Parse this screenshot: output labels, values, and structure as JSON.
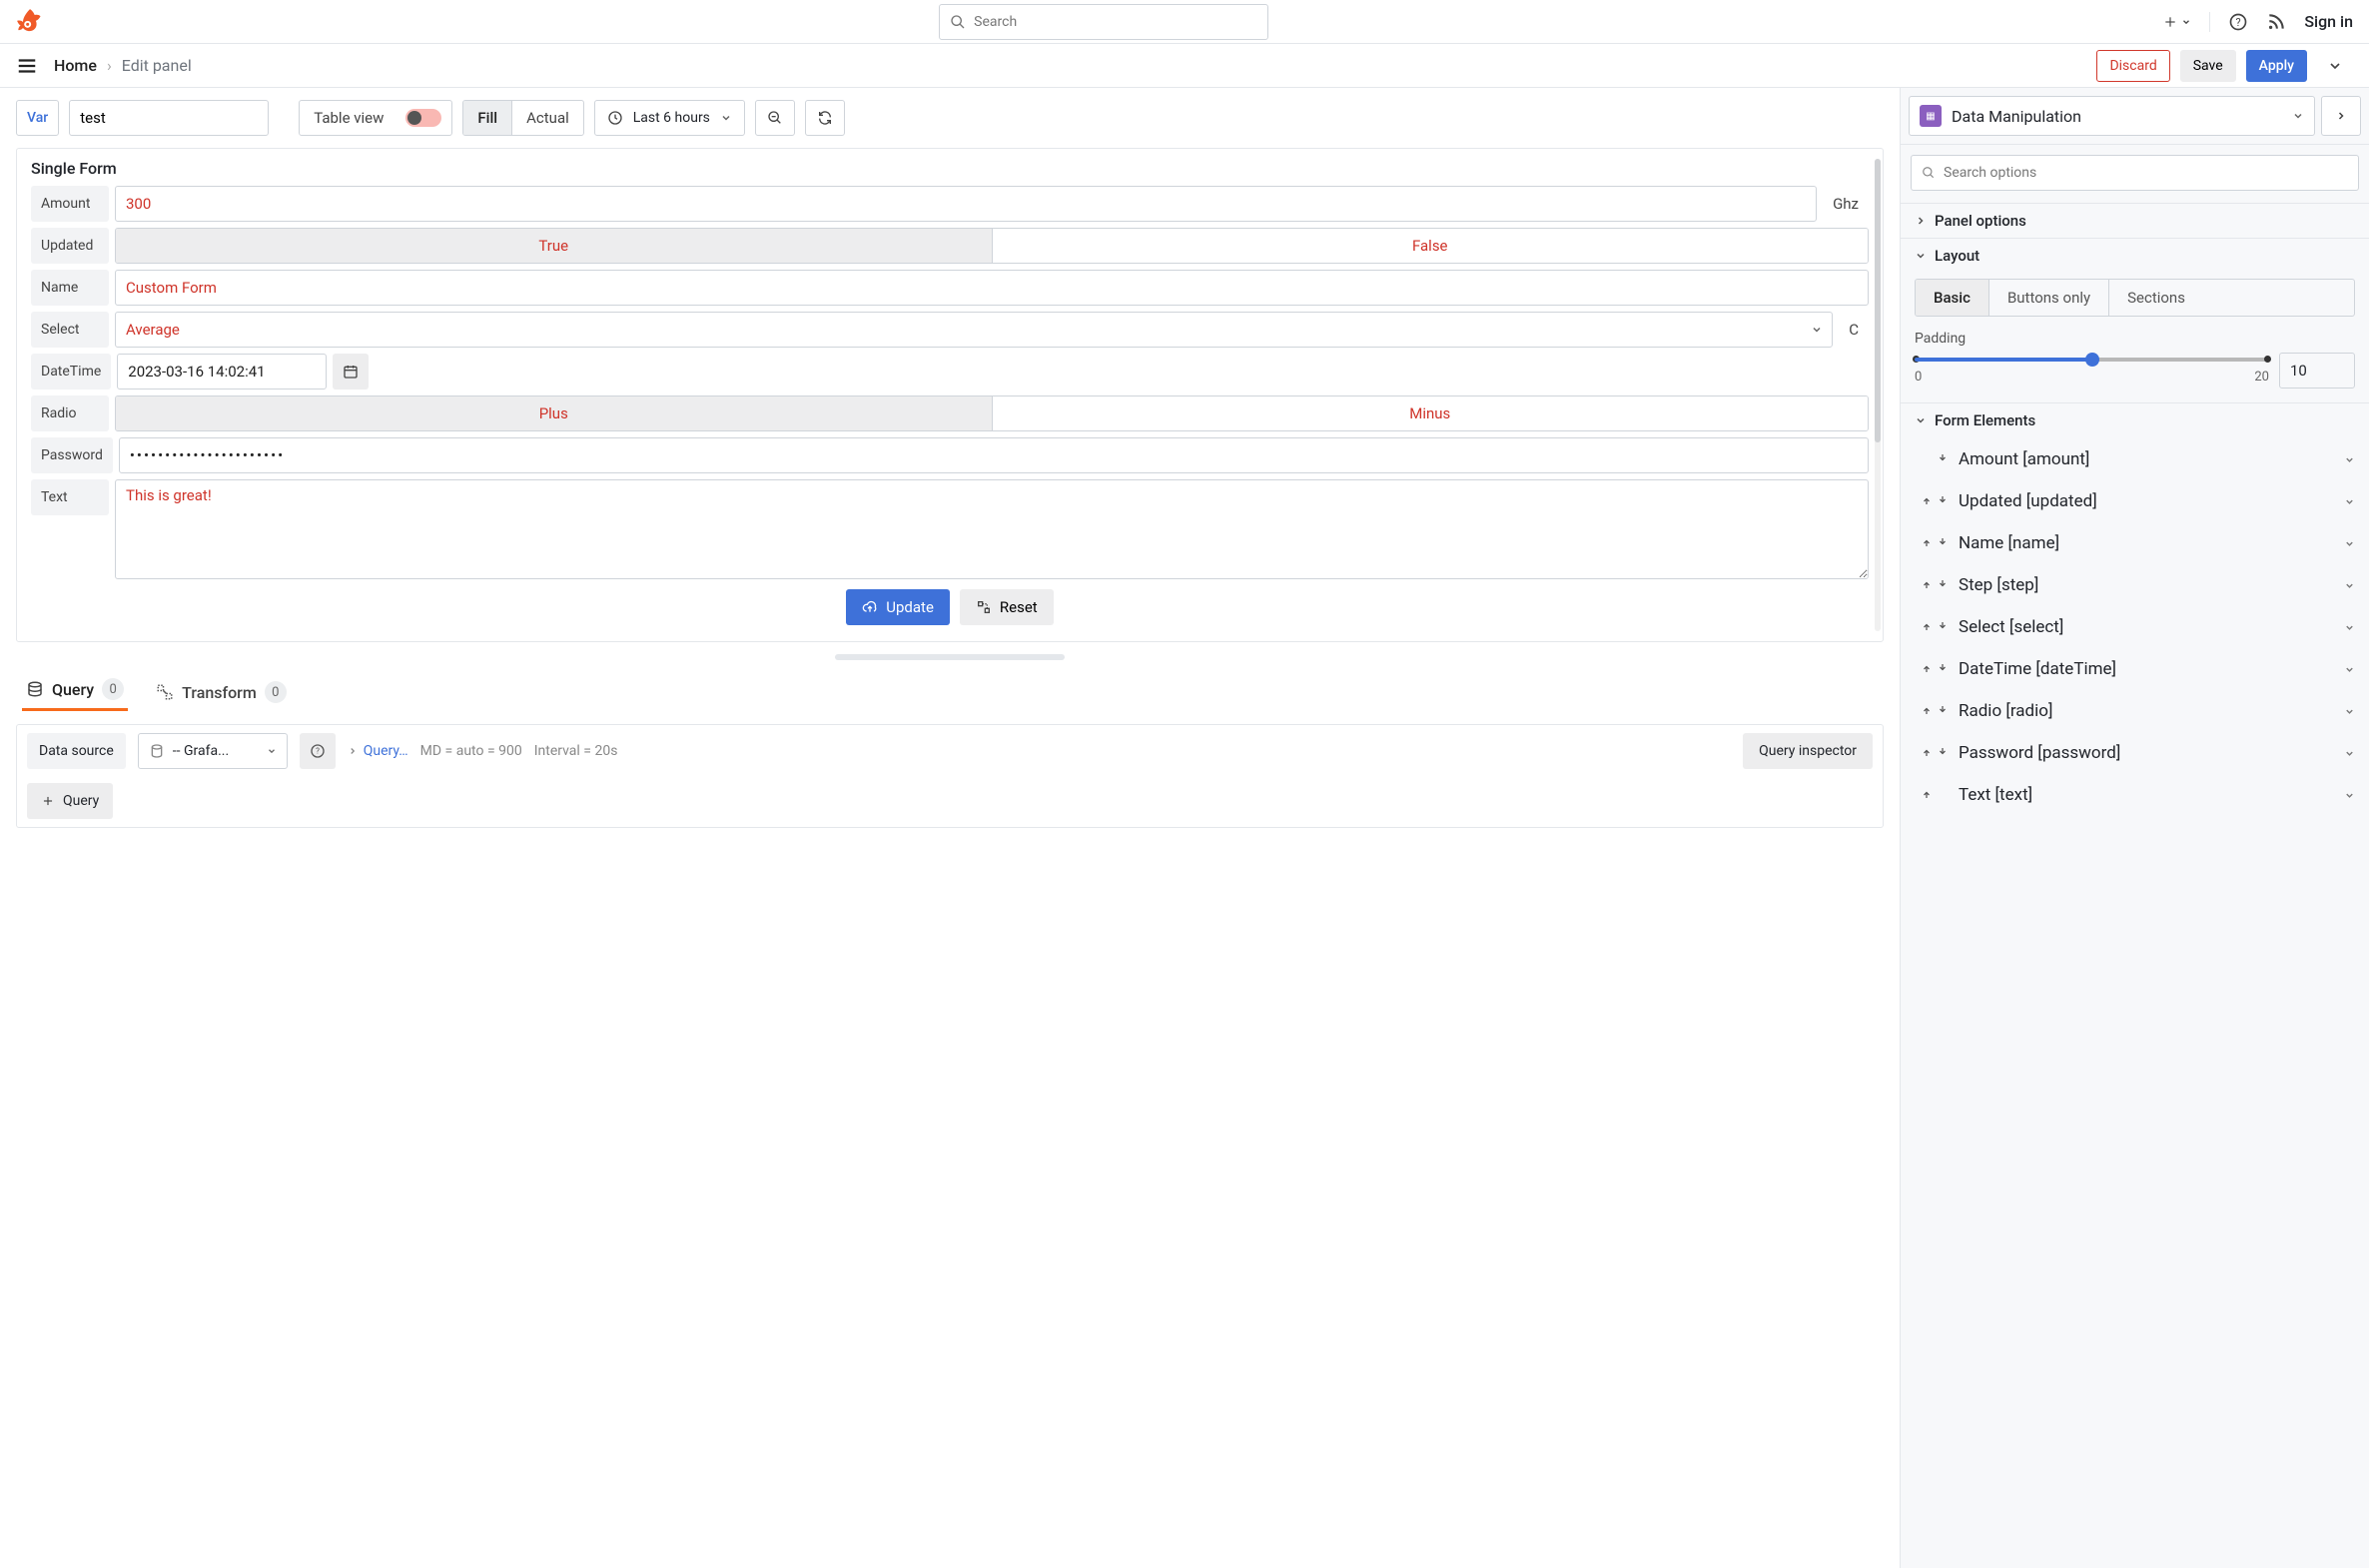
{
  "topbar": {
    "search_placeholder": "Search",
    "signin": "Sign in"
  },
  "breadcrumb": {
    "home": "Home",
    "current": "Edit panel"
  },
  "actions": {
    "discard": "Discard",
    "save": "Save",
    "apply": "Apply"
  },
  "controls": {
    "var_label": "Var",
    "var_value": "test",
    "table_view": "Table view",
    "fill": "Fill",
    "actual": "Actual",
    "time_range": "Last 6 hours"
  },
  "panel": {
    "title": "Single Form",
    "update": "Update",
    "reset": "Reset",
    "fields": {
      "amount": {
        "label": "Amount",
        "value": "300",
        "suffix": "Ghz"
      },
      "updated": {
        "label": "Updated",
        "opt_true": "True",
        "opt_false": "False"
      },
      "name": {
        "label": "Name",
        "value": "Custom Form"
      },
      "select": {
        "label": "Select",
        "value": "Average",
        "suffix": "C"
      },
      "datetime": {
        "label": "DateTime",
        "value": "2023-03-16 14:02:41"
      },
      "radio": {
        "label": "Radio",
        "opt_a": "Plus",
        "opt_b": "Minus"
      },
      "password": {
        "label": "Password",
        "value": "••••••••••••••••••••••"
      },
      "text": {
        "label": "Text",
        "value": "This is great!"
      }
    }
  },
  "query": {
    "tab_query": "Query",
    "tab_transform": "Transform",
    "query_count": "0",
    "transform_count": "0",
    "data_source": "Data source",
    "ds_value": "-- Grafa...",
    "query_options": "Query…",
    "md_info": "MD = auto = 900",
    "interval_info": "Interval = 20s",
    "inspector": "Query inspector",
    "add_query": "Query"
  },
  "sidebar": {
    "plugin": "Data Manipulation",
    "search_placeholder": "Search options",
    "panel_options": "Panel options",
    "layout": {
      "title": "Layout",
      "basic": "Basic",
      "buttons_only": "Buttons only",
      "sections": "Sections",
      "padding_label": "Padding",
      "padding_value": "10",
      "min": "0",
      "max": "20"
    },
    "form_elements": {
      "title": "Form Elements",
      "items": [
        {
          "label": "Amount [amount]",
          "up": false,
          "down": true
        },
        {
          "label": "Updated [updated]",
          "up": true,
          "down": true
        },
        {
          "label": "Name [name]",
          "up": true,
          "down": true
        },
        {
          "label": "Step [step]",
          "up": true,
          "down": true
        },
        {
          "label": "Select [select]",
          "up": true,
          "down": true
        },
        {
          "label": "DateTime [dateTime]",
          "up": true,
          "down": true
        },
        {
          "label": "Radio [radio]",
          "up": true,
          "down": true
        },
        {
          "label": "Password [password]",
          "up": true,
          "down": true
        },
        {
          "label": "Text [text]",
          "up": true,
          "down": false
        }
      ]
    }
  }
}
